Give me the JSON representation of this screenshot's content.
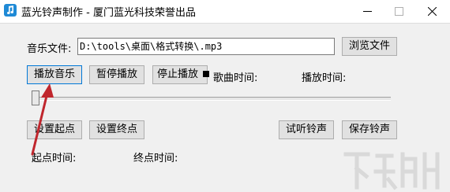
{
  "window": {
    "title": "蓝光铃声制作 - 厦门蓝光科技荣誉出品"
  },
  "file": {
    "label": "音乐文件:",
    "value": "D:\\tools\\桌面\\格式转换\\.mp3",
    "browse_label": "浏览文件"
  },
  "playback": {
    "play_label": "播放音乐",
    "pause_label": "暂停播放",
    "stop_label": "停止播放",
    "song_time_label": "歌曲时间:",
    "play_time_label": "播放时间:"
  },
  "slider": {
    "position": 0
  },
  "points": {
    "set_start_label": "设置起点",
    "set_end_label": "设置终点",
    "preview_label": "试听铃声",
    "save_label": "保存铃声",
    "start_time_label": "起点时间:",
    "end_time_label": "终点时间:"
  },
  "colors": {
    "arrow": "#c0262d",
    "focus": "#0078d7",
    "app_icon": "#1f8ad6"
  },
  "icons": {
    "app": "music-note-icon",
    "stop": "stop-square-icon",
    "minimize": "minimize-icon",
    "maximize": "maximize-icon",
    "close": "close-icon"
  }
}
